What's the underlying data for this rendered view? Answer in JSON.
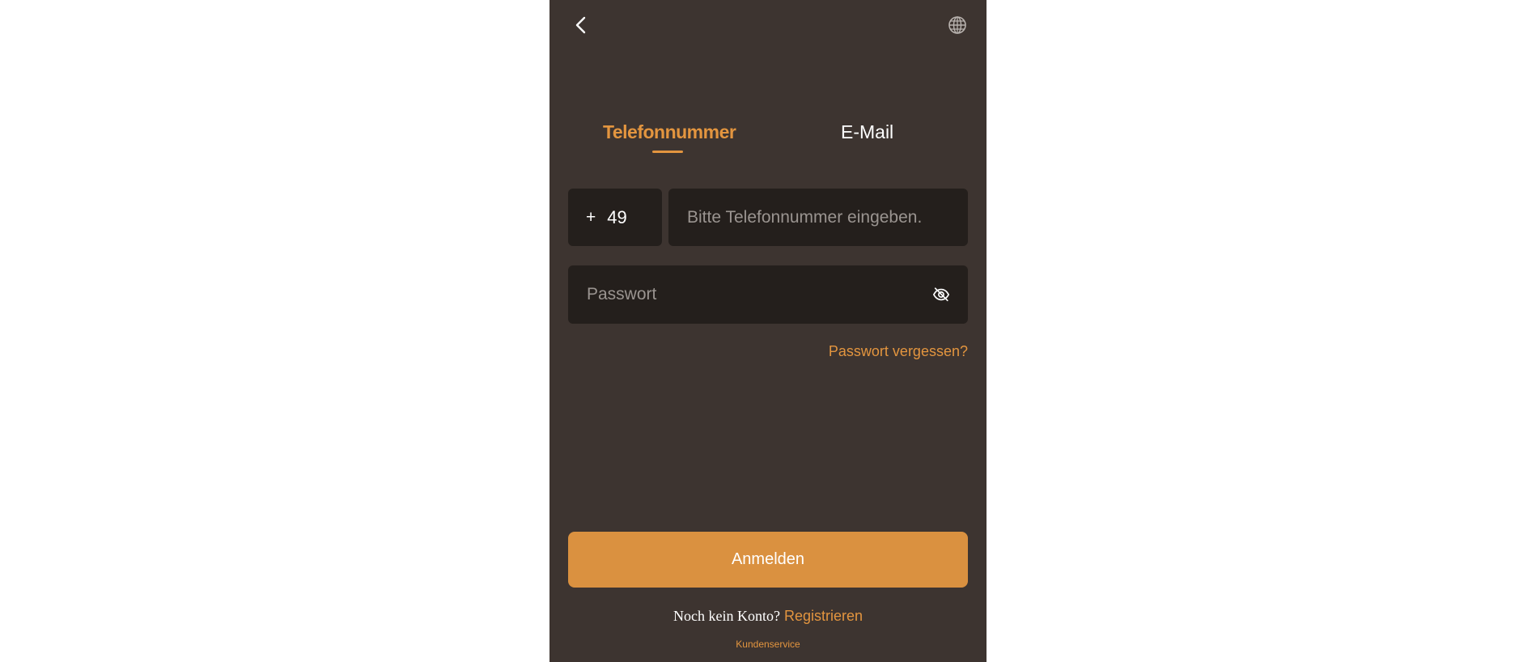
{
  "header": {
    "back_icon": "chevron-left-icon",
    "language_icon": "globe-icon"
  },
  "tabs": [
    {
      "label": "Telefonnummer",
      "active": true
    },
    {
      "label": "E-Mail",
      "active": false
    }
  ],
  "phone": {
    "plus": "+",
    "country_code": "49",
    "placeholder": "Bitte Telefonnummer eingeben.",
    "value": ""
  },
  "password": {
    "placeholder": "Passwort",
    "value": "",
    "toggle_icon": "eye-off-icon"
  },
  "forgot_label": "Passwort vergessen?",
  "login_label": "Anmelden",
  "register": {
    "question": "Noch kein Konto?",
    "link_label": "Registrieren"
  },
  "service_label": "Kundenservice",
  "colors": {
    "accent": "#e3953f",
    "button": "#da9140",
    "background": "#3d3430",
    "field": "#241f1c"
  }
}
